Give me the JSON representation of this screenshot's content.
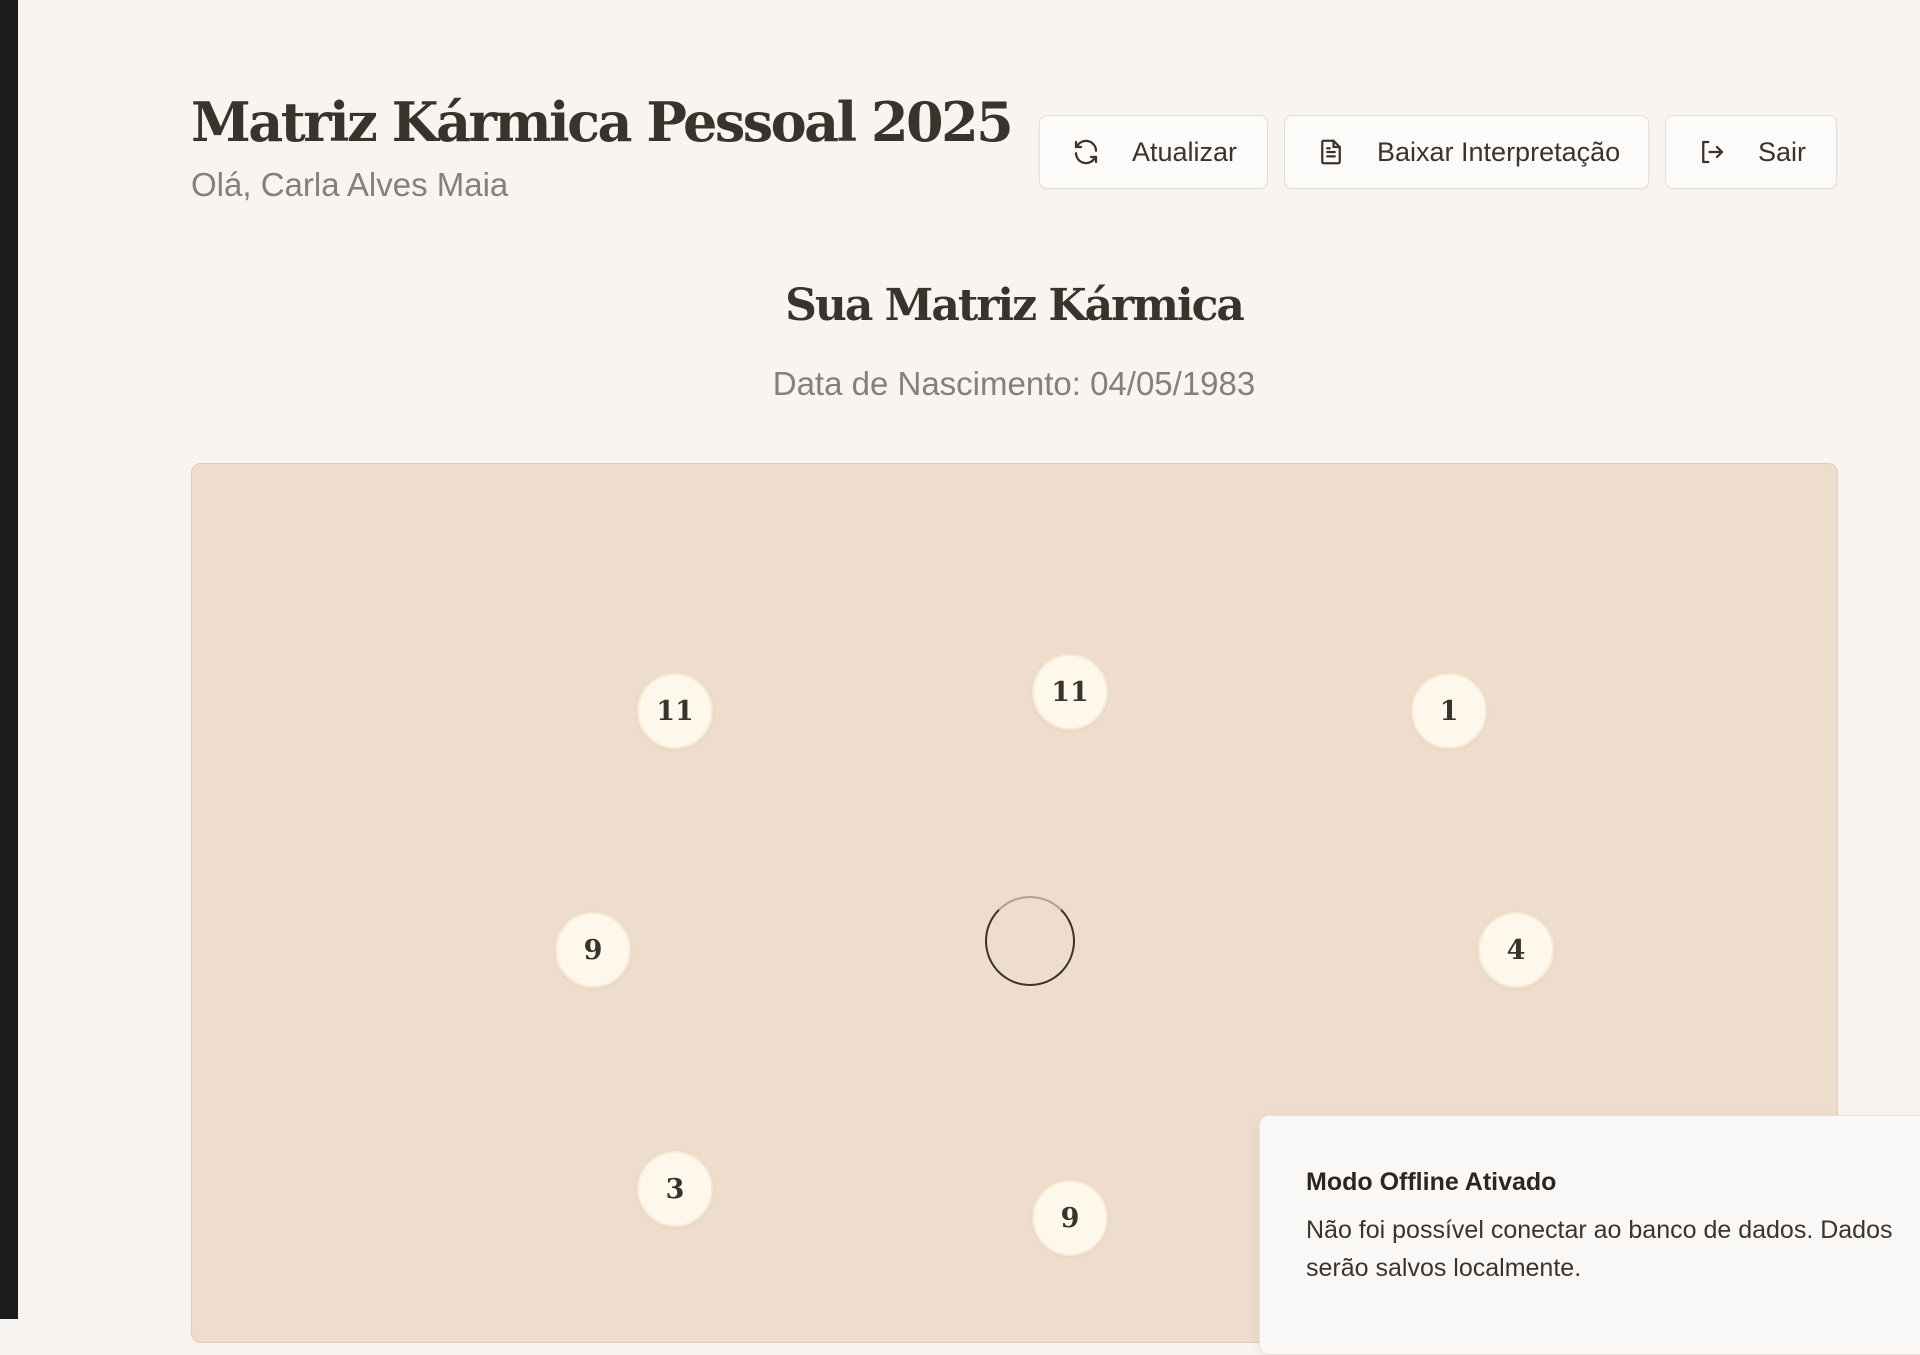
{
  "header": {
    "title": "Matriz Kármica Pessoal 2025",
    "greeting": "Olá, Carla Alves Maia"
  },
  "actions": {
    "refresh": {
      "label": "Atualizar",
      "icon": "refresh-icon"
    },
    "download": {
      "label": "Baixar Interpretação",
      "icon": "document-icon"
    },
    "logout": {
      "label": "Sair",
      "icon": "logout-icon"
    }
  },
  "section": {
    "title": "Sua Matriz Kármica",
    "birth_date": "Data de Nascimento: 04/05/1983"
  },
  "matrix": {
    "top_left": "11",
    "top": "11",
    "top_right": "1",
    "left": "9",
    "right": "4",
    "bottom_left": "3",
    "bottom": "9",
    "center_status": "loading"
  },
  "toast": {
    "title": "Modo Offline Ativado",
    "message": "Não foi possível conectar ao banco de dados. Dados serão salvos localmente."
  },
  "colors": {
    "page_background": "#f7f4f1",
    "panel_background": "#eedccd",
    "node_background": "#fdf7ec",
    "text_dark": "#3a332b",
    "text_muted": "#8a7f76"
  }
}
